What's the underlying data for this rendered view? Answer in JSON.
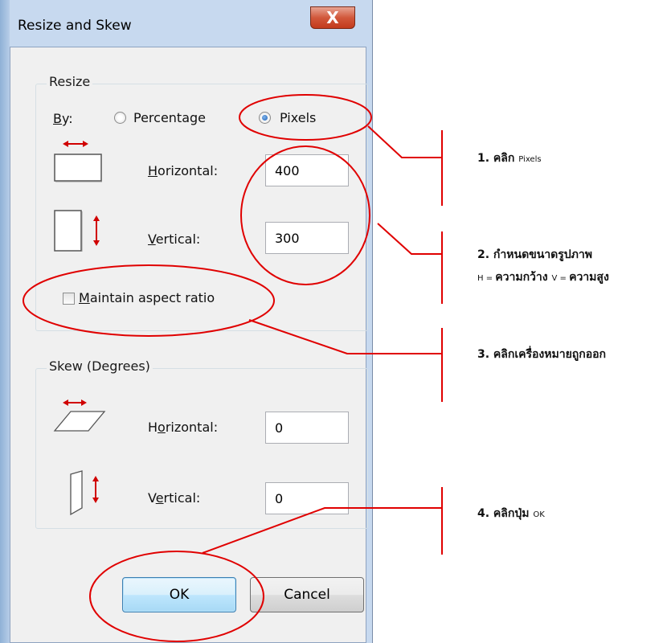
{
  "window": {
    "title": "Resize and Skew",
    "close_glyph": "X"
  },
  "resize": {
    "group_label": "Resize",
    "by_label": "By:",
    "by_label_underlined": "B",
    "by_label_rest": "y:",
    "percentage_label": "Percentage",
    "pixels_label": "Pixels",
    "selected": "Pixels",
    "horizontal_underlined": "H",
    "horizontal_rest": "orizontal:",
    "horizontal_value": "400",
    "vertical_underlined": "V",
    "vertical_rest": "ertical:",
    "vertical_value": "300",
    "maintain_underlined": "M",
    "maintain_rest": "aintain aspect ratio",
    "maintain_checked": false
  },
  "skew": {
    "group_label": "Skew (Degrees)",
    "horizontal_pre": "H",
    "horizontal_underlined": "o",
    "horizontal_rest": "rizontal:",
    "horizontal_value": "0",
    "vertical_pre": "V",
    "vertical_underlined": "e",
    "vertical_rest": "rtical:",
    "vertical_value": "0"
  },
  "buttons": {
    "ok": "OK",
    "cancel": "Cancel"
  },
  "annotations": {
    "step1_main": "1. คลิก ",
    "step1_small": "Pixels",
    "step2_line1": "2. กำหนดขนาดรูปภาพ",
    "step2_h": "H = ",
    "step2_h_text": "ความกว้าง ",
    "step2_v": "V = ",
    "step2_v_text": "ความสูง",
    "step3": "3. คลิกเครื่องหมายถูกออก",
    "step4_main": "4. คลิกปุ่ม ",
    "step4_small": "OK"
  },
  "colors": {
    "annotation": "#e00000",
    "icon_arrow": "#d00000"
  }
}
